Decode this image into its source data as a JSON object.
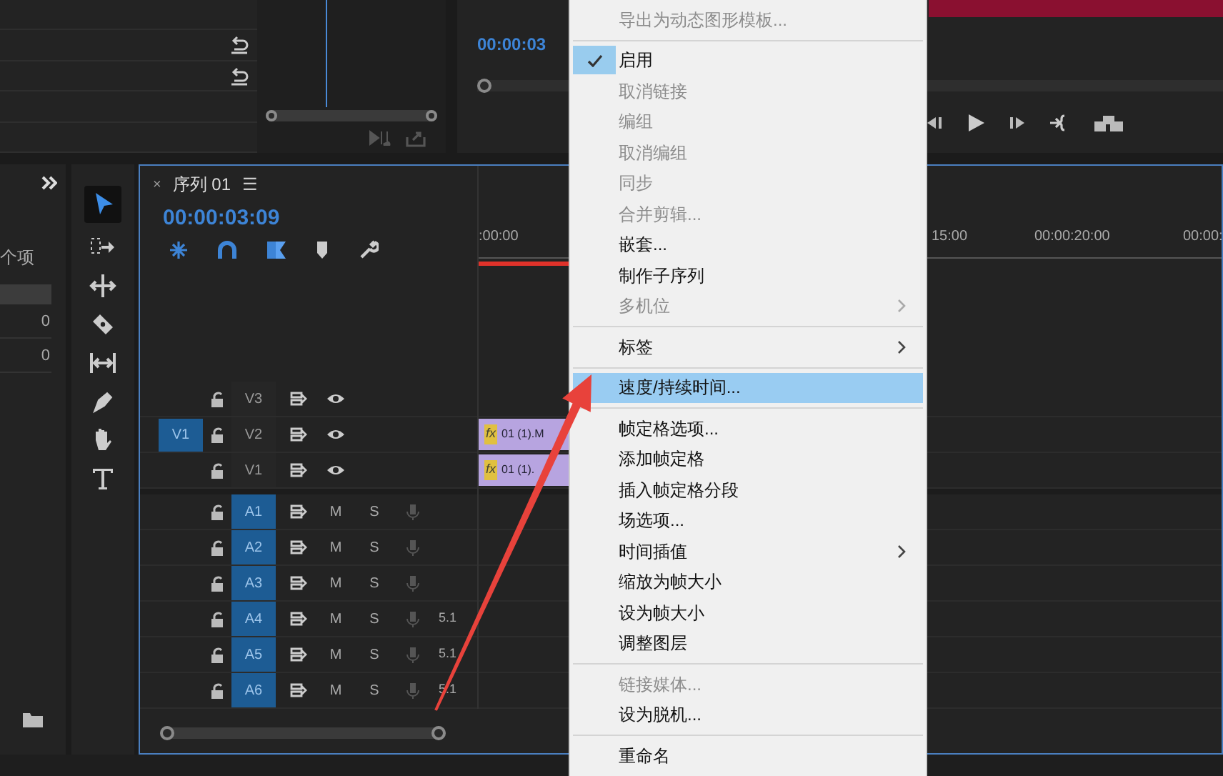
{
  "effect_controls": {
    "rows": [
      {
        "resettable": false
      },
      {
        "resettable": true
      },
      {
        "resettable": true
      },
      {
        "resettable": false
      },
      {
        "resettable": false
      }
    ]
  },
  "program_monitor": {
    "timecode": "00:00:03"
  },
  "project_panel": {
    "label": "个项",
    "cells": [
      "0",
      "0"
    ]
  },
  "tools": [
    {
      "kind": "selection",
      "selected": true
    },
    {
      "kind": "track-select",
      "selected": false
    },
    {
      "kind": "ripple",
      "selected": false
    },
    {
      "kind": "razor",
      "selected": false
    },
    {
      "kind": "slip",
      "selected": false
    },
    {
      "kind": "pen",
      "selected": false
    },
    {
      "kind": "hand",
      "selected": false
    },
    {
      "kind": "type",
      "selected": false
    }
  ],
  "timeline": {
    "close": "×",
    "title": "序列 01",
    "menu": "☰",
    "timecode": "00:00:03:09",
    "ruler": [
      ":00:00",
      "15:00",
      "00:00:20:00",
      "00:00:"
    ],
    "tracks": [
      {
        "kind": "video",
        "name": "V3",
        "targeted": false
      },
      {
        "kind": "video",
        "name": "V2",
        "targeted": false,
        "source": "V1"
      },
      {
        "kind": "video",
        "name": "V1",
        "targeted": false
      },
      {
        "kind": "audio",
        "name": "A1",
        "targeted": true,
        "mute": "M",
        "solo": "S"
      },
      {
        "kind": "audio",
        "name": "A2",
        "targeted": true,
        "mute": "M",
        "solo": "S"
      },
      {
        "kind": "audio",
        "name": "A3",
        "targeted": true,
        "mute": "M",
        "solo": "S"
      },
      {
        "kind": "audio",
        "name": "A4",
        "targeted": true,
        "mute": "M",
        "solo": "S",
        "channels": "5.1"
      },
      {
        "kind": "audio",
        "name": "A5",
        "targeted": true,
        "mute": "M",
        "solo": "S",
        "channels": "5.1"
      },
      {
        "kind": "audio",
        "name": "A6",
        "targeted": true,
        "mute": "M",
        "solo": "S",
        "channels": "5.1"
      }
    ],
    "clips": [
      {
        "badge": "fx",
        "label": "01 (1).M"
      },
      {
        "badge": "fx",
        "label": "01 (1)."
      }
    ]
  },
  "context_menu": [
    {
      "kind": "item",
      "label": "导出为动态图形模板...",
      "disabled": true,
      "checked": false,
      "submenu": false,
      "selected": false
    },
    {
      "kind": "separator"
    },
    {
      "kind": "item",
      "label": "启用",
      "disabled": false,
      "checked": true,
      "submenu": false,
      "selected": false
    },
    {
      "kind": "item",
      "label": "取消链接",
      "disabled": true,
      "checked": false,
      "submenu": false,
      "selected": false
    },
    {
      "kind": "item",
      "label": "编组",
      "disabled": true,
      "checked": false,
      "submenu": false,
      "selected": false
    },
    {
      "kind": "item",
      "label": "取消编组",
      "disabled": true,
      "checked": false,
      "submenu": false,
      "selected": false
    },
    {
      "kind": "item",
      "label": "同步",
      "disabled": true,
      "checked": false,
      "submenu": false,
      "selected": false
    },
    {
      "kind": "item",
      "label": "合并剪辑...",
      "disabled": true,
      "checked": false,
      "submenu": false,
      "selected": false
    },
    {
      "kind": "item",
      "label": "嵌套...",
      "disabled": false,
      "checked": false,
      "submenu": false,
      "selected": false
    },
    {
      "kind": "item",
      "label": "制作子序列",
      "disabled": false,
      "checked": false,
      "submenu": false,
      "selected": false
    },
    {
      "kind": "item",
      "label": "多机位",
      "disabled": true,
      "checked": false,
      "submenu": true,
      "selected": false
    },
    {
      "kind": "separator"
    },
    {
      "kind": "item",
      "label": "标签",
      "disabled": false,
      "checked": false,
      "submenu": true,
      "selected": false
    },
    {
      "kind": "separator"
    },
    {
      "kind": "item",
      "label": "速度/持续时间...",
      "disabled": false,
      "checked": false,
      "submenu": false,
      "selected": true
    },
    {
      "kind": "separator"
    },
    {
      "kind": "item",
      "label": "帧定格选项...",
      "disabled": false,
      "checked": false,
      "submenu": false,
      "selected": false
    },
    {
      "kind": "item",
      "label": "添加帧定格",
      "disabled": false,
      "checked": false,
      "submenu": false,
      "selected": false
    },
    {
      "kind": "item",
      "label": "插入帧定格分段",
      "disabled": false,
      "checked": false,
      "submenu": false,
      "selected": false
    },
    {
      "kind": "item",
      "label": "场选项...",
      "disabled": false,
      "checked": false,
      "submenu": false,
      "selected": false
    },
    {
      "kind": "item",
      "label": "时间插值",
      "disabled": false,
      "checked": false,
      "submenu": true,
      "selected": false
    },
    {
      "kind": "item",
      "label": "缩放为帧大小",
      "disabled": false,
      "checked": false,
      "submenu": false,
      "selected": false
    },
    {
      "kind": "item",
      "label": "设为帧大小",
      "disabled": false,
      "checked": false,
      "submenu": false,
      "selected": false
    },
    {
      "kind": "item",
      "label": "调整图层",
      "disabled": false,
      "checked": false,
      "submenu": false,
      "selected": false
    },
    {
      "kind": "separator"
    },
    {
      "kind": "item",
      "label": "链接媒体...",
      "disabled": true,
      "checked": false,
      "submenu": false,
      "selected": false
    },
    {
      "kind": "item",
      "label": "设为脱机...",
      "disabled": false,
      "checked": false,
      "submenu": false,
      "selected": false
    },
    {
      "kind": "separator"
    },
    {
      "kind": "item",
      "label": "重命名",
      "disabled": false,
      "checked": false,
      "submenu": false,
      "selected": false
    }
  ]
}
